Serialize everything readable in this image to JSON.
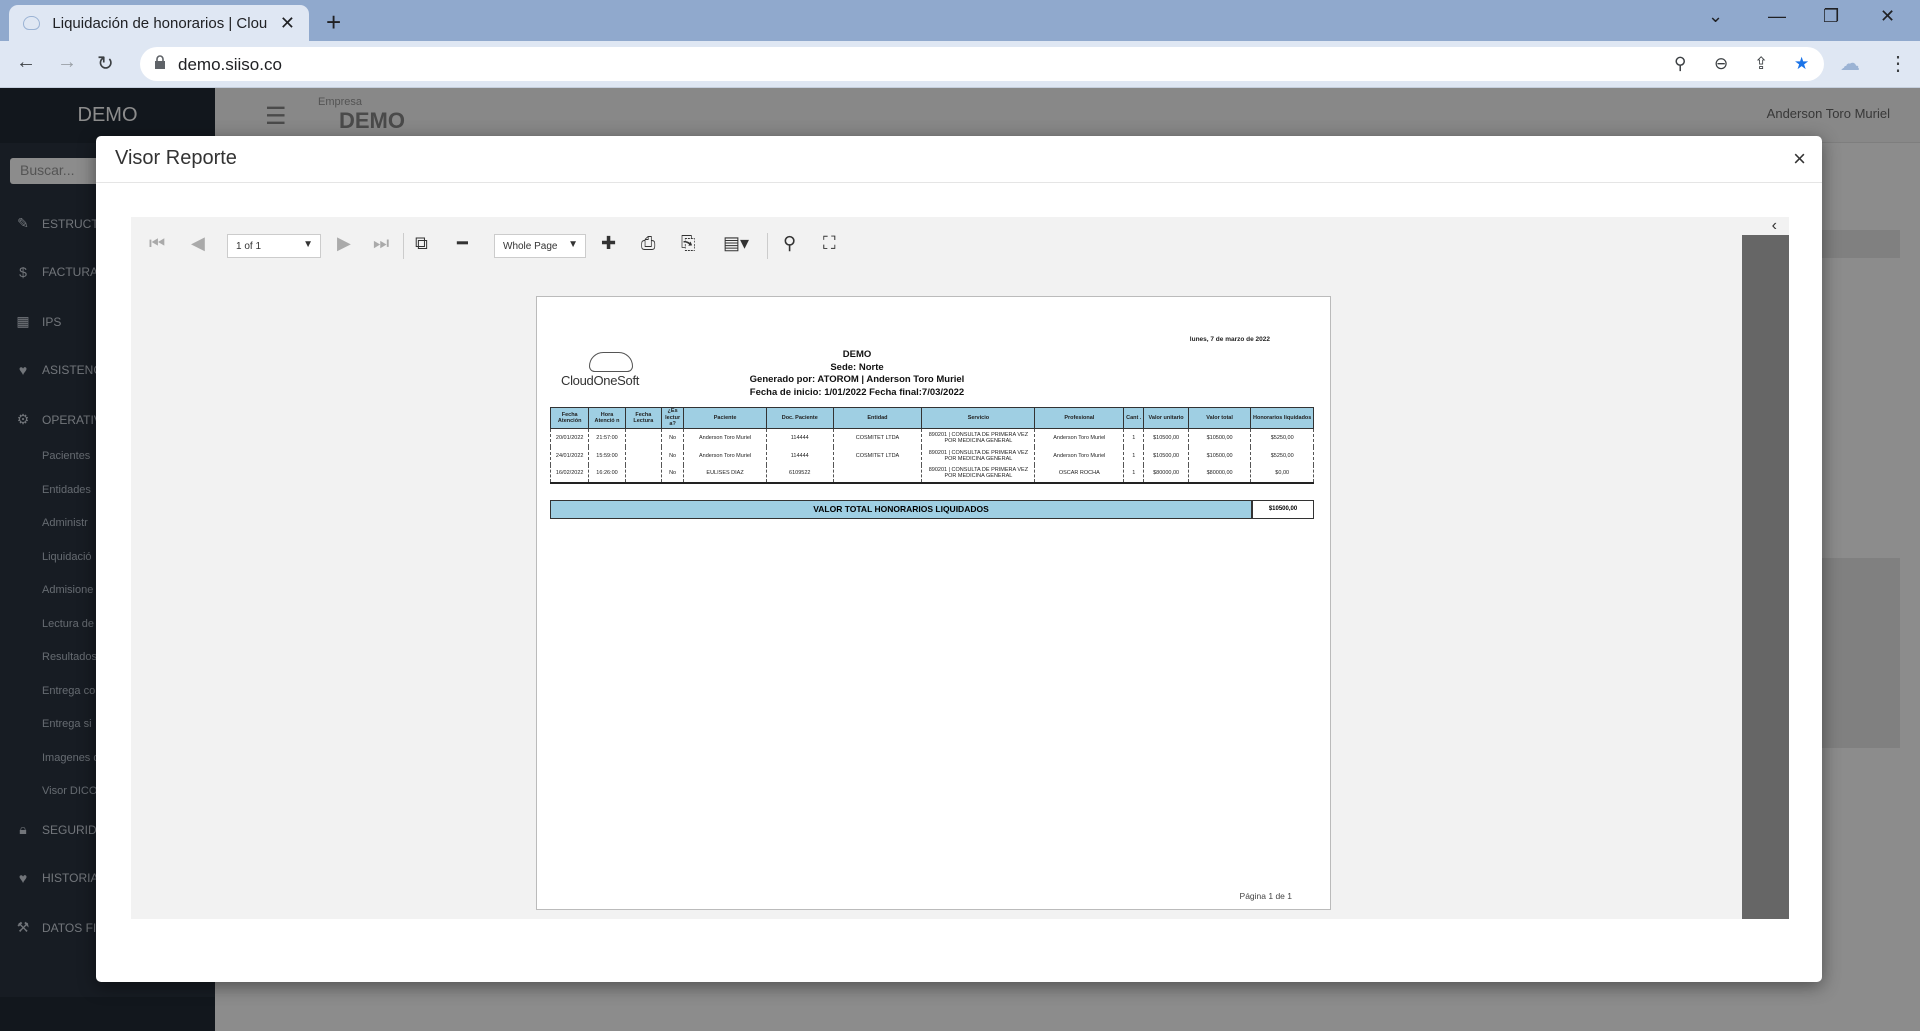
{
  "browser": {
    "tab_title": "Liquidación de honorarios | Clou",
    "url": "demo.siiso.co"
  },
  "app": {
    "brand": "DEMO",
    "search_placeholder": "Buscar...",
    "empresa_label": "Empresa",
    "empresa_name": "DEMO",
    "user": "Anderson Toro Muriel",
    "sidebar_items": [
      {
        "label": "ESTRUCTU",
        "icon": "wrench-icon"
      },
      {
        "label": "FACTURAC",
        "icon": "dollar-icon"
      },
      {
        "label": "IPS",
        "icon": "building-icon"
      },
      {
        "label": "ASISTENCI",
        "icon": "heartbeat-icon"
      },
      {
        "label": "OPERATIV",
        "icon": "gears-icon"
      }
    ],
    "sidebar_subitems": [
      "Pacientes",
      "Entidades",
      "Administr",
      "Liquidació",
      "Admisione",
      "Lectura de",
      "Resultados",
      "Entrega co",
      "Entrega si",
      "Imagenes d",
      "Visor DICO"
    ],
    "sidebar_items_2": [
      {
        "label": "SEGURIDA",
        "icon": "lock-icon"
      },
      {
        "label": "HISTORIAS",
        "icon": "heartbeat-icon"
      },
      {
        "label": "DATOS FIJ",
        "icon": "gavel-icon"
      }
    ]
  },
  "modal": {
    "title": "Visor Reporte",
    "close": "×"
  },
  "viewer": {
    "page_selector": "1 of 1",
    "zoom_selector": "Whole Page"
  },
  "report": {
    "date": "lunes, 7 de marzo de 2022",
    "logo_text": "CloudOneSoft",
    "header_lines": [
      "DEMO",
      "Sede: Norte",
      "Generado por: ATOROM | Anderson Toro Muriel",
      "Fecha de inicio: 1/01/2022 Fecha final:7/03/2022"
    ],
    "columns": [
      "Fecha Atención",
      "Hora Atenció n",
      "Fecha Lectura",
      "¿Es lectur a?",
      "Paciente",
      "Doc. Paciente",
      "Entidad",
      "Servicio",
      "Profesional",
      "Cant .",
      "Valor unitario",
      "Valor total",
      "Honorarios liquidados"
    ],
    "rows": [
      [
        "20/01/2022",
        "21:57:00",
        "",
        "No",
        "Anderson Toro Muriel",
        "114444",
        "COSMITET LTDA",
        "890201 | CONSULTA DE PRIMERA VEZ POR MEDICINA GENERAL",
        "Anderson Toro Muriel",
        "1",
        "$10500,00",
        "$10500,00",
        "$5250,00"
      ],
      [
        "24/01/2022",
        "15:59:00",
        "",
        "No",
        "Anderson Toro Muriel",
        "114444",
        "COSMITET LTDA",
        "890201 | CONSULTA DE PRIMERA VEZ POR MEDICINA GENERAL",
        "Anderson Toro Muriel",
        "1",
        "$10500,00",
        "$10500,00",
        "$5250,00"
      ],
      [
        "16/02/2022",
        "16:26:00",
        "",
        "No",
        "EULISES DIAZ",
        "6109522",
        "",
        "890201 | CONSULTA DE PRIMERA VEZ POR MEDICINA GENERAL",
        "OSCAR ROCHA",
        "1",
        "$80000,00",
        "$80000,00",
        "$0,00"
      ]
    ],
    "total_label": "VALOR TOTAL HONORARIOS LIQUIDADOS",
    "total_value": "$10500,00",
    "footer": "Página 1 de 1"
  }
}
